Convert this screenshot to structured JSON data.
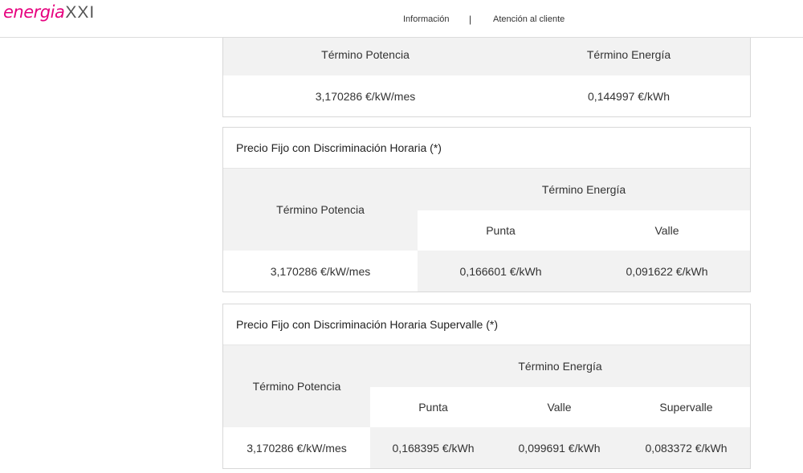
{
  "header": {
    "logo_script": "energia",
    "logo_xxi": "XXI",
    "nav": [
      {
        "label": "Información"
      },
      {
        "label": "Atención al cliente"
      }
    ],
    "separator": "|"
  },
  "card1": {
    "headers": [
      "Término Potencia",
      "Término Energía"
    ],
    "values": [
      "3,170286 €/kW/mes",
      "0,144997 €/kWh"
    ]
  },
  "card2": {
    "title": "Precio Fijo con Discriminación Horaria (*)",
    "potencia_header": "Término Potencia",
    "energia_header": "Término Energía",
    "periods": [
      "Punta",
      "Valle"
    ],
    "values": [
      "3,170286 €/kW/mes",
      "0,166601 €/kWh",
      "0,091622 €/kWh"
    ]
  },
  "card3": {
    "title": "Precio Fijo con Discriminación Horaria Supervalle (*)",
    "potencia_header": "Término Potencia",
    "energia_header": "Término Energía",
    "periods": [
      "Punta",
      "Valle",
      "Supervalle"
    ],
    "values": [
      "3,170286 €/kW/mes",
      "0,168395 €/kWh",
      "0,099691 €/kWh",
      "0,083372 €/kWh"
    ]
  },
  "colors": {
    "brand_pink": "#e6007e",
    "header_bg": "#f2f2f2",
    "border": "#d8d8d8"
  }
}
